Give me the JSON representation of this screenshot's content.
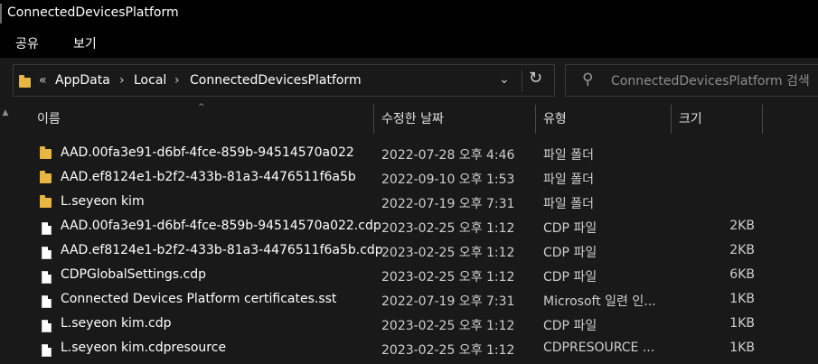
{
  "window": {
    "title": "ConnectedDevicesPlatform"
  },
  "ribbon": {
    "tabs": [
      "공유",
      "보기"
    ]
  },
  "address": {
    "overflow": "«",
    "breadcrumbs": [
      "AppData",
      "Local",
      "ConnectedDevicesPlatform"
    ]
  },
  "search": {
    "placeholder": "ConnectedDevicesPlatform 검색"
  },
  "columns": {
    "name": "이름",
    "date": "수정한 날짜",
    "type": "유형",
    "size": "크기"
  },
  "files": [
    {
      "icon": "folder-icon",
      "name": "AAD.00fa3e91-d6bf-4fce-859b-94514570a022",
      "date": "2022-07-28 오후 4:46",
      "type": "파일 폴더",
      "size": ""
    },
    {
      "icon": "folder-icon",
      "name": "AAD.ef8124e1-b2f2-433b-81a3-4476511f6a5b",
      "date": "2022-09-10 오후 1:53",
      "type": "파일 폴더",
      "size": ""
    },
    {
      "icon": "folder-icon",
      "name": "L.seyeon kim",
      "date": "2022-07-19 오후 7:31",
      "type": "파일 폴더",
      "size": ""
    },
    {
      "icon": "file-icon",
      "name": "AAD.00fa3e91-d6bf-4fce-859b-94514570a022.cdp",
      "date": "2023-02-25 오후 1:12",
      "type": "CDP 파일",
      "size": "2KB"
    },
    {
      "icon": "file-icon",
      "name": "AAD.ef8124e1-b2f2-433b-81a3-4476511f6a5b.cdp",
      "date": "2023-02-25 오후 1:12",
      "type": "CDP 파일",
      "size": "2KB"
    },
    {
      "icon": "file-icon",
      "name": "CDPGlobalSettings.cdp",
      "date": "2023-02-25 오후 1:12",
      "type": "CDP 파일",
      "size": "6KB"
    },
    {
      "icon": "file-icon",
      "name": "Connected Devices Platform certificates.sst",
      "date": "2022-07-19 오후 7:31",
      "type": "Microsoft 일련 인...",
      "size": "1KB"
    },
    {
      "icon": "file-icon",
      "name": "L.seyeon kim.cdp",
      "date": "2023-02-25 오후 1:12",
      "type": "CDP 파일",
      "size": "1KB"
    },
    {
      "icon": "file-icon",
      "name": "L.seyeon kim.cdpresource",
      "date": "2023-02-25 오후 1:12",
      "type": "CDPRESOURCE ...",
      "size": "1KB"
    }
  ]
}
